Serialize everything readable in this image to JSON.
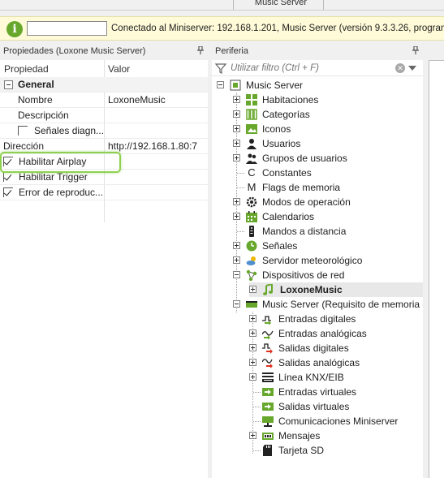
{
  "top_tab": {
    "label": "Music Server"
  },
  "infobar": {
    "input_value": "",
    "message": "Conectado al Miniserver: 192.168.1.201, Music Server (versión 9.3.3.26,  programa"
  },
  "props_pane": {
    "title": "Propiedades (Loxone Music Server)",
    "col_property": "Propiedad",
    "col_value": "Valor",
    "rows": [
      {
        "name": "General",
        "value": ""
      },
      {
        "name": "Nombre",
        "value": "LoxoneMusic"
      },
      {
        "name": "Descripción",
        "value": ""
      },
      {
        "name": "Señales diagn...",
        "value": ""
      },
      {
        "name": "Dirección",
        "value": "http://192.168.1.80:7"
      },
      {
        "name": "Habilitar Airplay",
        "value": ""
      },
      {
        "name": "Habilitar Trigger",
        "value": ""
      },
      {
        "name": "Error de reproduc...",
        "value": ""
      }
    ]
  },
  "tree_pane": {
    "title": "Periferia",
    "filter_placeholder": "Utilizar filtro (Ctrl + F)",
    "items": [
      {
        "label": "Music Server",
        "icon": "music-server-icon"
      },
      {
        "label": "Habitaciones",
        "icon": "rooms-icon"
      },
      {
        "label": "Categorías",
        "icon": "categories-icon"
      },
      {
        "label": "Iconos",
        "icon": "image-icon"
      },
      {
        "label": "Usuarios",
        "icon": "user-icon"
      },
      {
        "label": "Grupos de usuarios",
        "icon": "user-group-icon"
      },
      {
        "label": "Constantes",
        "icon": "constant-icon"
      },
      {
        "label": "Flags de memoria",
        "icon": "memory-flag-icon"
      },
      {
        "label": "Modos de operación",
        "icon": "gear-icon"
      },
      {
        "label": "Calendarios",
        "icon": "calendar-icon"
      },
      {
        "label": "Mandos a distancia",
        "icon": "remote-icon"
      },
      {
        "label": "Señales",
        "icon": "clock-icon"
      },
      {
        "label": "Servidor meteorológico",
        "icon": "weather-icon"
      },
      {
        "label": "Dispositivos de red",
        "icon": "network-icon"
      },
      {
        "label": "LoxoneMusic",
        "icon": "music-note-icon"
      },
      {
        "label": "Music Server (Requisito de memoria c",
        "icon": "music-server-device-icon"
      },
      {
        "label": "Entradas digitales",
        "icon": "digital-input-icon"
      },
      {
        "label": "Entradas analógicas",
        "icon": "analog-input-icon"
      },
      {
        "label": "Salidas digitales",
        "icon": "digital-output-icon"
      },
      {
        "label": "Salidas analógicas",
        "icon": "analog-output-icon"
      },
      {
        "label": "Línea KNX/EIB",
        "icon": "knx-icon"
      },
      {
        "label": "Entradas virtuales",
        "icon": "virtual-input-icon"
      },
      {
        "label": "Salidas virtuales",
        "icon": "virtual-output-icon"
      },
      {
        "label": "Comunicaciones Miniserver",
        "icon": "miniserver-comm-icon"
      },
      {
        "label": "Mensajes",
        "icon": "messages-icon"
      },
      {
        "label": "Tarjeta SD",
        "icon": "sd-card-icon"
      }
    ]
  },
  "colors": {
    "accent_green": "#67a82c",
    "highlight": "#8fd14f",
    "info_bg": "#fffbd8"
  }
}
